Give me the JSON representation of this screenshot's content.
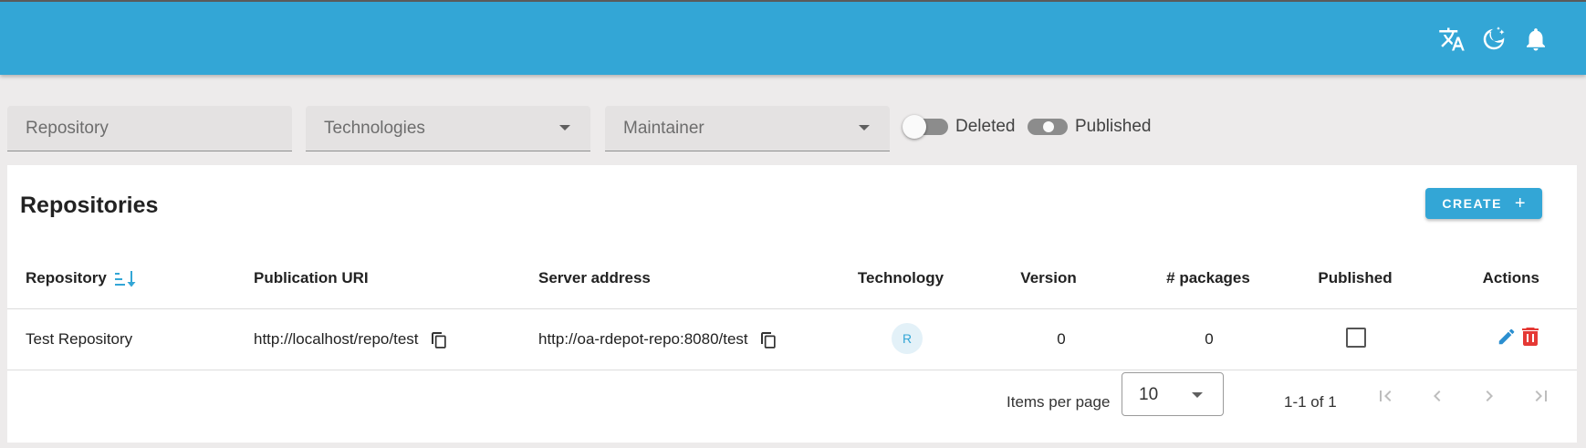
{
  "header": {
    "icons": [
      "translate-icon",
      "dark-mode-icon",
      "notifications-icon"
    ],
    "color": "#33a6d6"
  },
  "filters": {
    "repository_placeholder": "Repository",
    "technologies_label": "Technologies",
    "maintainer_label": "Maintainer",
    "deleted_label": "Deleted",
    "published_label": "Published"
  },
  "card": {
    "title": "Repositories",
    "create_label": "CREATE",
    "create_icon": "+"
  },
  "table": {
    "columns": {
      "repository": "Repository",
      "publication_uri": "Publication URI",
      "server_address": "Server address",
      "technology": "Technology",
      "version": "Version",
      "packages": "# packages",
      "published": "Published",
      "actions": "Actions"
    },
    "sort": {
      "column": "repository",
      "direction": "ascending"
    },
    "rows": [
      {
        "repository": "Test Repository",
        "publication_uri": "http://localhost/repo/test",
        "server_address": "http://oa-rdepot-repo:8080/test",
        "technology": "R",
        "version": "0",
        "packages": "0",
        "published": false
      }
    ]
  },
  "pagination": {
    "items_per_page_label": "Items per page",
    "items_per_page": "10",
    "range": "1-1 of 1"
  },
  "colors": {
    "accent": "#33a6d6",
    "edit": "#2b8fd0",
    "delete": "#e53935"
  }
}
